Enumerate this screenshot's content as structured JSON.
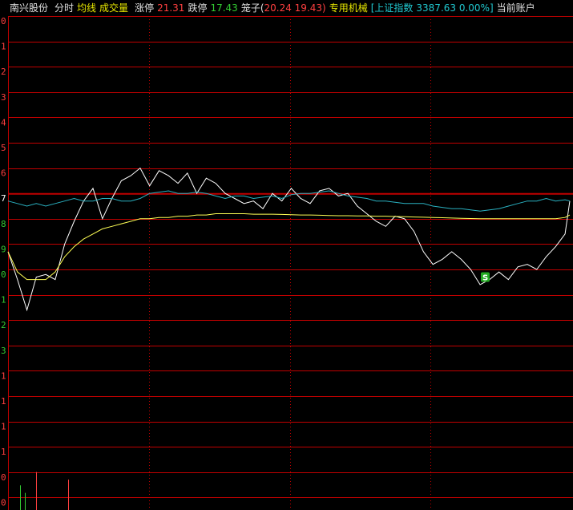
{
  "header": {
    "stock_name": "南兴股份",
    "tab_fenshi": "分时",
    "tab_junxian": "均线",
    "tab_volume": "成交量",
    "limit_up_label": "涨停",
    "limit_up_value": "21.31",
    "limit_down_label": "跌停",
    "limit_down_value": "17.43",
    "cage_label": "笼子(",
    "cage_value": "20.24 19.43)",
    "sector": "专用机械",
    "index_label": "[上证指数",
    "index_value": "3387.63 0.00%]",
    "account": "当前账户"
  },
  "colors": {
    "background": "#000000",
    "grid": "#c00000",
    "price_line": "#ffffff",
    "avg_line": "#ffff55",
    "index_line": "#2ab0c0",
    "up": "#ff4040",
    "down": "#33cc33",
    "label_yellow": "#e8e800",
    "label_cyan": "#20c8d0"
  },
  "chart_data": {
    "type": "line",
    "y_tick_labels": [
      {
        "text": "0",
        "color": "#ff4040"
      },
      {
        "text": "1",
        "color": "#ff4040"
      },
      {
        "text": "2",
        "color": "#ff4040"
      },
      {
        "text": "3",
        "color": "#ff4040"
      },
      {
        "text": "4",
        "color": "#ff4040"
      },
      {
        "text": "5",
        "color": "#ff4040"
      },
      {
        "text": "6",
        "color": "#ff4040"
      },
      {
        "text": "7",
        "color": "#ffffff"
      },
      {
        "text": "8",
        "color": "#33cc33"
      },
      {
        "text": "9",
        "color": "#33cc33"
      },
      {
        "text": "0",
        "color": "#33cc33"
      },
      {
        "text": "1",
        "color": "#33cc33"
      },
      {
        "text": "2",
        "color": "#33cc33"
      },
      {
        "text": "3",
        "color": "#33cc33"
      },
      {
        "text": "1",
        "color": "#ff4040"
      },
      {
        "text": "1",
        "color": "#ff4040"
      },
      {
        "text": "1",
        "color": "#ff4040"
      },
      {
        "text": "1",
        "color": "#ff4040"
      },
      {
        "text": "0",
        "color": "#ff4040"
      },
      {
        "text": "0",
        "color": "#ff4040"
      }
    ],
    "price_levels": 14,
    "volume_levels": 6,
    "vertical_divisions": 4,
    "x_steps": 120,
    "prev_close_level": 7,
    "signal_marker": {
      "text": "S",
      "x": 101,
      "level": 10.3
    },
    "series": [
      {
        "points": [
          [
            0,
            9.3
          ],
          [
            2,
            10.4
          ],
          [
            4,
            11.6
          ],
          [
            6,
            10.3
          ],
          [
            8,
            10.2
          ],
          [
            10,
            10.4
          ],
          [
            12,
            9.0
          ],
          [
            14,
            8.1
          ],
          [
            16,
            7.3
          ],
          [
            18,
            6.8
          ],
          [
            20,
            8.0
          ],
          [
            22,
            7.2
          ],
          [
            24,
            6.5
          ],
          [
            26,
            6.3
          ],
          [
            28,
            6.0
          ],
          [
            30,
            6.7
          ],
          [
            32,
            6.1
          ],
          [
            34,
            6.3
          ],
          [
            36,
            6.6
          ],
          [
            38,
            6.2
          ],
          [
            40,
            7.0
          ],
          [
            42,
            6.4
          ],
          [
            44,
            6.6
          ],
          [
            46,
            7.0
          ],
          [
            48,
            7.2
          ],
          [
            50,
            7.4
          ],
          [
            52,
            7.3
          ],
          [
            54,
            7.6
          ],
          [
            56,
            7.0
          ],
          [
            58,
            7.3
          ],
          [
            60,
            6.8
          ],
          [
            62,
            7.2
          ],
          [
            64,
            7.4
          ],
          [
            66,
            6.9
          ],
          [
            68,
            6.8
          ],
          [
            70,
            7.1
          ],
          [
            72,
            7.0
          ],
          [
            74,
            7.5
          ],
          [
            76,
            7.8
          ],
          [
            78,
            8.1
          ],
          [
            80,
            8.3
          ],
          [
            82,
            7.9
          ],
          [
            84,
            8.0
          ],
          [
            86,
            8.5
          ],
          [
            88,
            9.3
          ],
          [
            90,
            9.8
          ],
          [
            92,
            9.6
          ],
          [
            94,
            9.3
          ],
          [
            96,
            9.6
          ],
          [
            98,
            10.0
          ],
          [
            100,
            10.6
          ],
          [
            102,
            10.4
          ],
          [
            104,
            10.1
          ],
          [
            106,
            10.4
          ],
          [
            108,
            9.9
          ],
          [
            110,
            9.8
          ],
          [
            112,
            10.0
          ],
          [
            114,
            9.5
          ],
          [
            116,
            9.1
          ],
          [
            118,
            8.6
          ],
          [
            119,
            7.3
          ]
        ]
      },
      {
        "points": [
          [
            0,
            9.3
          ],
          [
            2,
            10.1
          ],
          [
            4,
            10.4
          ],
          [
            6,
            10.4
          ],
          [
            8,
            10.4
          ],
          [
            10,
            10.1
          ],
          [
            12,
            9.5
          ],
          [
            14,
            9.1
          ],
          [
            16,
            8.8
          ],
          [
            18,
            8.6
          ],
          [
            20,
            8.4
          ],
          [
            22,
            8.3
          ],
          [
            24,
            8.2
          ],
          [
            26,
            8.1
          ],
          [
            28,
            8.0
          ],
          [
            30,
            8.0
          ],
          [
            32,
            7.95
          ],
          [
            34,
            7.95
          ],
          [
            36,
            7.9
          ],
          [
            38,
            7.9
          ],
          [
            40,
            7.85
          ],
          [
            42,
            7.85
          ],
          [
            44,
            7.8
          ],
          [
            46,
            7.8
          ],
          [
            48,
            7.8
          ],
          [
            50,
            7.8
          ],
          [
            52,
            7.82
          ],
          [
            54,
            7.82
          ],
          [
            56,
            7.82
          ],
          [
            58,
            7.83
          ],
          [
            60,
            7.84
          ],
          [
            62,
            7.85
          ],
          [
            64,
            7.85
          ],
          [
            66,
            7.86
          ],
          [
            68,
            7.87
          ],
          [
            70,
            7.88
          ],
          [
            72,
            7.88
          ],
          [
            74,
            7.89
          ],
          [
            76,
            7.89
          ],
          [
            78,
            7.9
          ],
          [
            80,
            7.9
          ],
          [
            82,
            7.91
          ],
          [
            84,
            7.92
          ],
          [
            86,
            7.93
          ],
          [
            88,
            7.94
          ],
          [
            90,
            7.95
          ],
          [
            92,
            7.96
          ],
          [
            94,
            7.97
          ],
          [
            96,
            7.98
          ],
          [
            98,
            7.99
          ],
          [
            100,
            8.0
          ],
          [
            102,
            8.0
          ],
          [
            104,
            8.0
          ],
          [
            106,
            8.0
          ],
          [
            108,
            8.0
          ],
          [
            110,
            8.0
          ],
          [
            112,
            8.0
          ],
          [
            114,
            8.0
          ],
          [
            116,
            8.0
          ],
          [
            118,
            7.95
          ],
          [
            119,
            7.85
          ]
        ]
      },
      {
        "points": [
          [
            0,
            7.3
          ],
          [
            2,
            7.4
          ],
          [
            4,
            7.5
          ],
          [
            6,
            7.4
          ],
          [
            8,
            7.5
          ],
          [
            10,
            7.4
          ],
          [
            12,
            7.3
          ],
          [
            14,
            7.2
          ],
          [
            16,
            7.3
          ],
          [
            18,
            7.3
          ],
          [
            20,
            7.2
          ],
          [
            22,
            7.2
          ],
          [
            24,
            7.3
          ],
          [
            26,
            7.3
          ],
          [
            28,
            7.2
          ],
          [
            30,
            7.0
          ],
          [
            32,
            6.95
          ],
          [
            34,
            6.9
          ],
          [
            36,
            7.0
          ],
          [
            38,
            7.0
          ],
          [
            40,
            6.95
          ],
          [
            42,
            7.0
          ],
          [
            44,
            7.1
          ],
          [
            46,
            7.2
          ],
          [
            48,
            7.1
          ],
          [
            50,
            7.1
          ],
          [
            52,
            7.2
          ],
          [
            54,
            7.15
          ],
          [
            56,
            7.1
          ],
          [
            58,
            7.2
          ],
          [
            60,
            7.05
          ],
          [
            62,
            7.0
          ],
          [
            64,
            7.0
          ],
          [
            66,
            6.95
          ],
          [
            68,
            6.9
          ],
          [
            70,
            7.0
          ],
          [
            72,
            7.1
          ],
          [
            74,
            7.15
          ],
          [
            76,
            7.2
          ],
          [
            78,
            7.3
          ],
          [
            80,
            7.3
          ],
          [
            82,
            7.35
          ],
          [
            84,
            7.4
          ],
          [
            86,
            7.4
          ],
          [
            88,
            7.4
          ],
          [
            90,
            7.5
          ],
          [
            92,
            7.55
          ],
          [
            94,
            7.6
          ],
          [
            96,
            7.6
          ],
          [
            98,
            7.65
          ],
          [
            100,
            7.7
          ],
          [
            102,
            7.65
          ],
          [
            104,
            7.6
          ],
          [
            106,
            7.5
          ],
          [
            108,
            7.4
          ],
          [
            110,
            7.3
          ],
          [
            112,
            7.3
          ],
          [
            114,
            7.2
          ],
          [
            116,
            7.3
          ],
          [
            118,
            7.25
          ],
          [
            119,
            7.3
          ]
        ]
      }
    ],
    "volume_bars": [
      {
        "x": 2.5,
        "value": 0.65,
        "color": "#33cc33"
      },
      {
        "x": 3.5,
        "value": 0.45,
        "color": "#33cc33"
      },
      {
        "x": 6,
        "value": 1.0,
        "color": "#ff4040"
      },
      {
        "x": 12.8,
        "value": 0.8,
        "color": "#ff4040"
      }
    ]
  }
}
